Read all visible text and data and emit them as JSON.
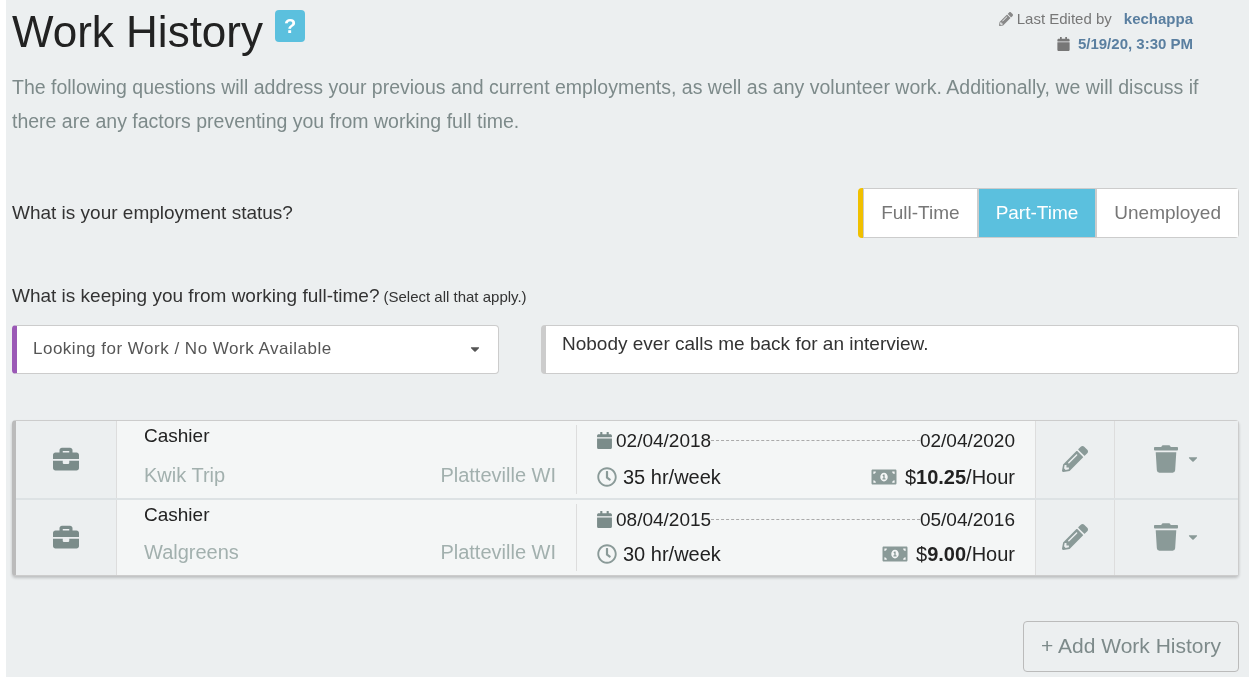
{
  "header": {
    "title": "Work History",
    "help": "?",
    "last_edited_label": "Last Edited by",
    "last_edited_user": "kechappa",
    "last_edited_date": "5/19/20, 3:30 PM"
  },
  "description": "The following questions will address your previous and current employments, as well as any volunteer work. Additionally, we will discuss if there are any factors preventing you from working full time.",
  "employment_status": {
    "question": "What is your employment status?",
    "options": [
      {
        "label": "Full-Time",
        "selected": false
      },
      {
        "label": "Part-Time",
        "selected": true
      },
      {
        "label": "Unemployed",
        "selected": false
      }
    ]
  },
  "barriers": {
    "question": "What is keeping you from working full-time?",
    "hint": "(Select all that apply.)",
    "dropdown_value": "Looking for Work / No Work Available",
    "comment_value": "Nobody ever calls me back for an interview."
  },
  "jobs": [
    {
      "title": "Cashier",
      "employer": "Kwik Trip",
      "location": "Platteville WI",
      "start": "02/04/2018",
      "end": "02/04/2020",
      "hours": "35 hr/week",
      "pay": "$**10.25**/Hour"
    },
    {
      "title": "Cashier",
      "employer": "Walgreens",
      "location": "Platteville WI",
      "start": "08/04/2015",
      "end": "05/04/2016",
      "hours": "30 hr/week",
      "pay": "$**9.00**/Hour"
    }
  ],
  "add_button": "+ Add Work History"
}
